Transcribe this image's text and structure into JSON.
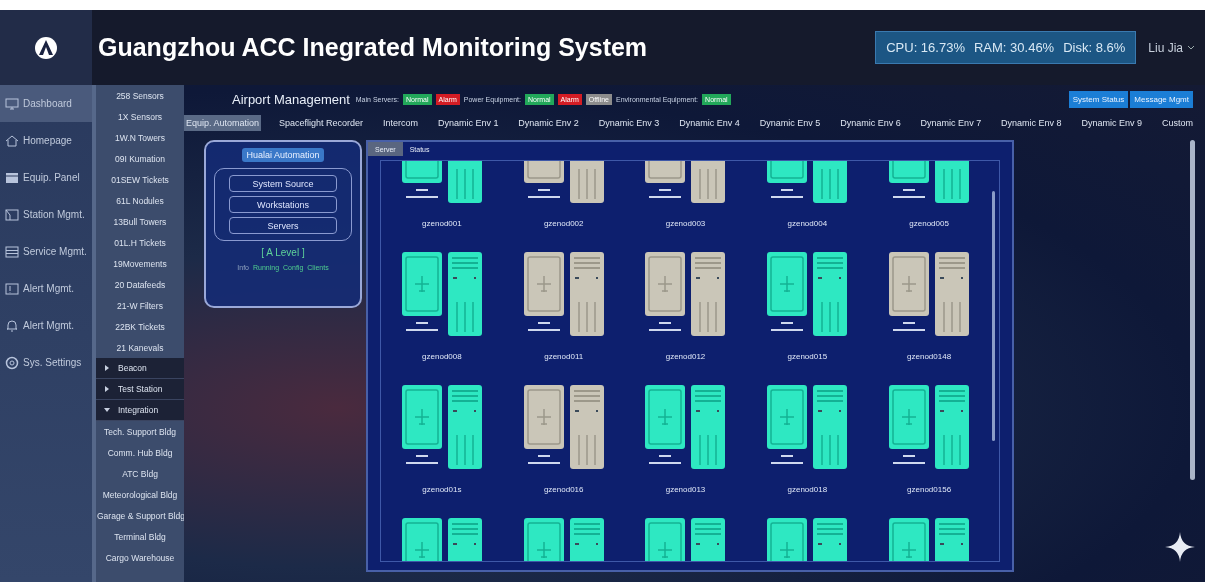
{
  "header": {
    "title": "Guangzhou ACC Inegrated Monitoring System",
    "stats": [
      "CPU: 16.73%",
      "RAM: 30.46%",
      "Disk: 8.6%"
    ],
    "user": "Liu Jia"
  },
  "nav": [
    {
      "label": "Dashboard",
      "selected": true
    },
    {
      "label": "Homepage",
      "selected": false
    },
    {
      "label": "Equip. Panel",
      "selected": false
    },
    {
      "label": "Station Mgmt.",
      "selected": false
    },
    {
      "label": "Service Mgmt.",
      "selected": false
    },
    {
      "label": "Alert Mgmt.",
      "selected": false
    },
    {
      "label": "Alert Mgmt.",
      "selected": false
    },
    {
      "label": "Sys. Settings",
      "selected": false
    }
  ],
  "sublist": [
    {
      "label": "258 Sensors",
      "kind": "item"
    },
    {
      "label": "1X Sensors",
      "kind": "item"
    },
    {
      "label": "1W.N Towers",
      "kind": "item"
    },
    {
      "label": "09I Kumation",
      "kind": "item"
    },
    {
      "label": "01SEW Tickets",
      "kind": "item"
    },
    {
      "label": "61L Nodules",
      "kind": "item"
    },
    {
      "label": "13Bull Towers",
      "kind": "item"
    },
    {
      "label": "01L.H Tickets",
      "kind": "item"
    },
    {
      "label": "19Movements",
      "kind": "item"
    },
    {
      "label": "20 Datafeeds",
      "kind": "item"
    },
    {
      "label": "21-W Filters",
      "kind": "item"
    },
    {
      "label": "22BK Tickets",
      "kind": "item"
    },
    {
      "label": "21 Kanevals",
      "kind": "item"
    },
    {
      "label": "Beacon",
      "kind": "group",
      "expanded": false
    },
    {
      "label": "Test Station",
      "kind": "group",
      "expanded": false
    },
    {
      "label": "Integration",
      "kind": "group",
      "expanded": true
    },
    {
      "label": "Tech. Support Bldg",
      "kind": "item"
    },
    {
      "label": "Comm. Hub Bldg",
      "kind": "item"
    },
    {
      "label": "ATC Bldg",
      "kind": "item"
    },
    {
      "label": "Meteorological Bldg",
      "kind": "item"
    },
    {
      "label": "Garage & Support Bldg",
      "kind": "item"
    },
    {
      "label": "Terminal Bldg",
      "kind": "item"
    },
    {
      "label": "Cargo Warehouse",
      "kind": "item"
    }
  ],
  "status_bar": {
    "title": "Airport Management",
    "groups": [
      {
        "label": "Main Servers:",
        "badges": [
          {
            "text": "Normal",
            "kind": "normal"
          },
          {
            "text": "Alarm",
            "kind": "alarm"
          }
        ]
      },
      {
        "label": "Power Equipment:",
        "badges": [
          {
            "text": "Normal",
            "kind": "normal"
          },
          {
            "text": "Alarm",
            "kind": "alarm"
          },
          {
            "text": "Offline",
            "kind": "offline"
          }
        ]
      },
      {
        "label": "Environmental Equipment:",
        "badges": [
          {
            "text": "Normal",
            "kind": "normal"
          }
        ]
      }
    ],
    "buttons": [
      "System Status",
      "Message Mgmt"
    ]
  },
  "tabs": [
    {
      "label": "Equip. Automation",
      "selected": true
    },
    {
      "label": "Spaceflight Recorder",
      "selected": false
    },
    {
      "label": "Intercom",
      "selected": false
    },
    {
      "label": "Dynamic Env 1",
      "selected": false
    },
    {
      "label": "Dynamic Env 2",
      "selected": false
    },
    {
      "label": "Dynamic Env 3",
      "selected": false
    },
    {
      "label": "Dynamic Env 4",
      "selected": false
    },
    {
      "label": "Dynamic Env 5",
      "selected": false
    },
    {
      "label": "Dynamic Env 6",
      "selected": false
    },
    {
      "label": "Dynamic Env 7",
      "selected": false
    },
    {
      "label": "Dynamic Env 8",
      "selected": false
    },
    {
      "label": "Dynamic Env 9",
      "selected": false
    },
    {
      "label": "Custom",
      "selected": false
    }
  ],
  "automation_panel": {
    "title": "Hualai Automation",
    "items": [
      "System Source",
      "Workstations",
      "Servers"
    ],
    "level": "[ A Level ]",
    "legend": [
      {
        "text": "Info",
        "kind": "info"
      },
      {
        "text": "Running",
        "kind": "status"
      },
      {
        "text": "Config",
        "kind": "status"
      },
      {
        "text": "Clients",
        "kind": "status"
      }
    ]
  },
  "server_panel": {
    "tabs": [
      {
        "label": "Server",
        "selected": true
      },
      {
        "label": "Status",
        "selected": false
      }
    ],
    "servers": [
      {
        "name": "gzenod001",
        "online": true
      },
      {
        "name": "gzenod002",
        "online": false
      },
      {
        "name": "gzenod003",
        "online": false
      },
      {
        "name": "gzenod004",
        "online": true
      },
      {
        "name": "gzenod005",
        "online": true
      },
      {
        "name": "gzenod008",
        "online": true
      },
      {
        "name": "gzenod011",
        "online": false
      },
      {
        "name": "gzenod012",
        "online": false
      },
      {
        "name": "gzenod015",
        "online": true
      },
      {
        "name": "gzenod0148",
        "online": false
      },
      {
        "name": "gzenod01s",
        "online": true
      },
      {
        "name": "gzenod016",
        "online": false
      },
      {
        "name": "gzenod013",
        "online": true
      },
      {
        "name": "gzenod018",
        "online": true
      },
      {
        "name": "gzenod0156",
        "online": true
      },
      {
        "online": true
      },
      {
        "online": true
      },
      {
        "online": true
      },
      {
        "online": true
      },
      {
        "online": true
      }
    ]
  }
}
